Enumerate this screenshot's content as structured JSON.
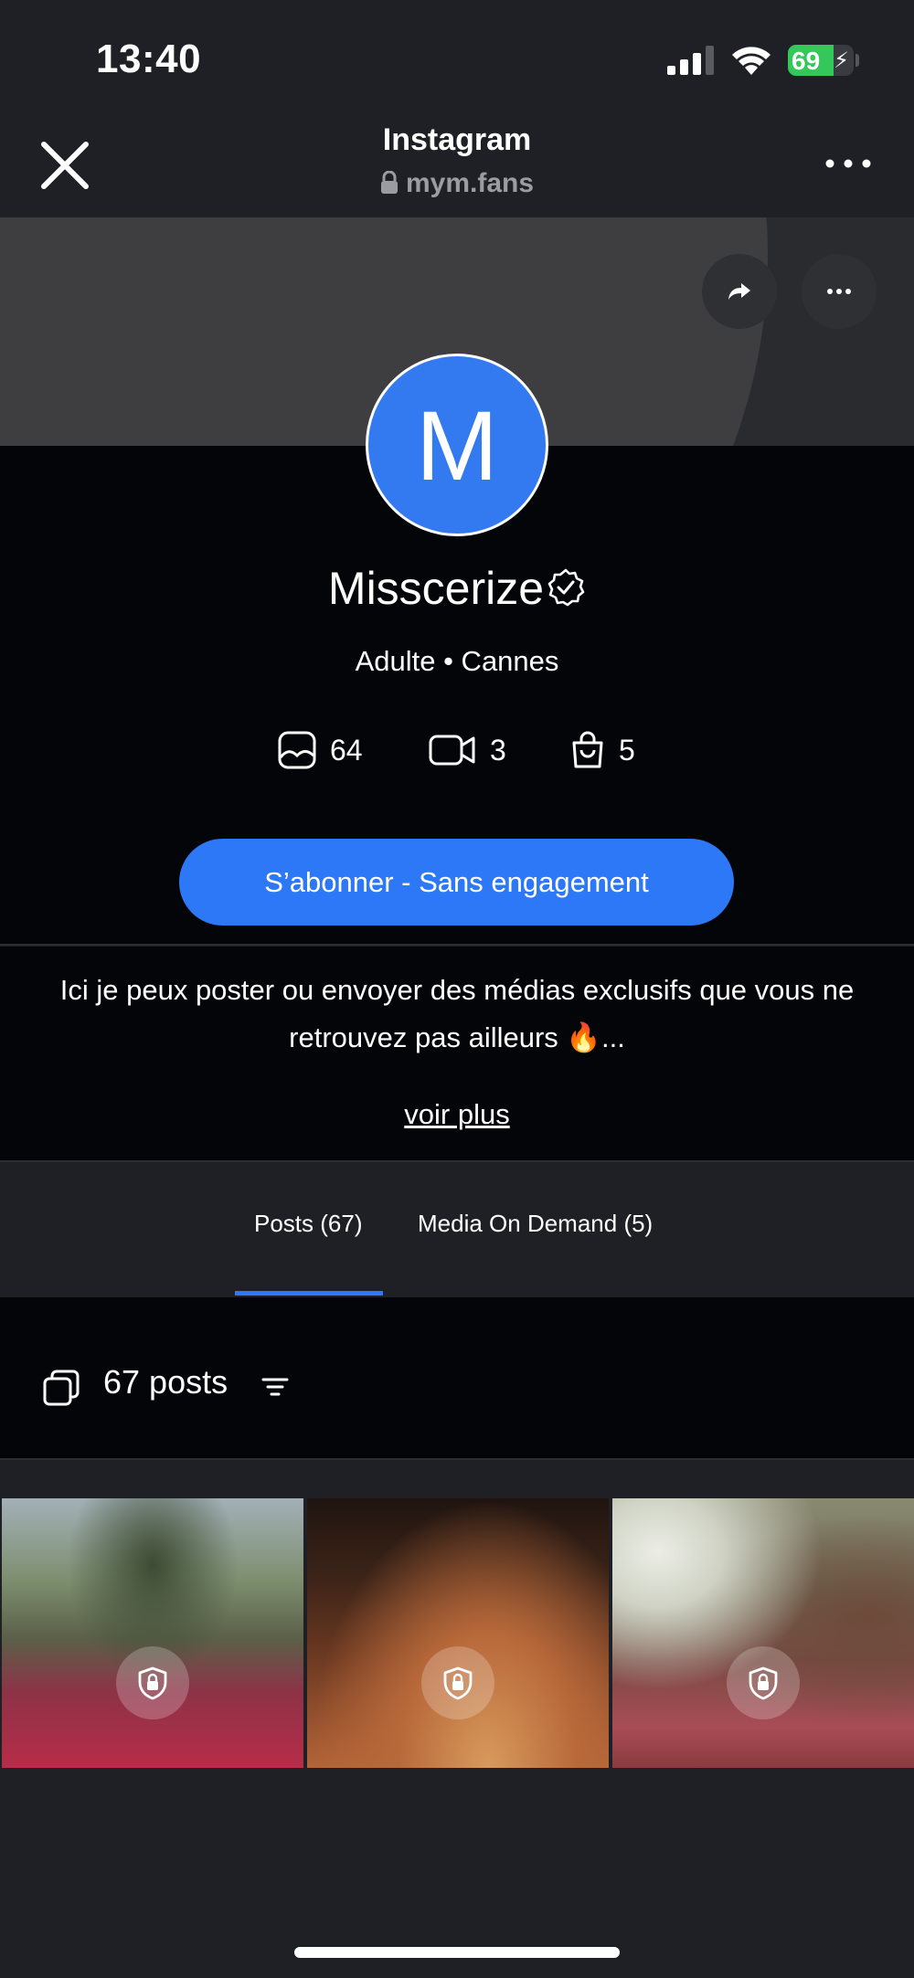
{
  "status_bar": {
    "time": "13:40",
    "battery_level": "69",
    "battery_fraction": 0.69,
    "icons": [
      "signal-icon",
      "wifi-icon",
      "battery-charging-icon"
    ]
  },
  "browser": {
    "title": "Instagram",
    "url": "mym.fans",
    "close_icon": "close-icon",
    "menu_icon": "more-icon"
  },
  "cover": {
    "actions": [
      "share-icon",
      "more-icon"
    ]
  },
  "profile": {
    "avatar_letter": "M",
    "avatar_color": "#3379f0",
    "name": "Misscerize",
    "verified_icon": "verified-badge-icon",
    "subtitle": "Adulte • Cannes",
    "stats": {
      "photos": "64",
      "videos": "3",
      "products": "5"
    },
    "subscribe_label": "S’abonner - Sans engagement",
    "accent_color": "#2d78f6"
  },
  "bio": {
    "text": "Ici je peux poster ou envoyer des médias exclusifs que vous ne retrouvez pas ailleurs 🔥...",
    "see_more": "voir plus"
  },
  "tabs": [
    {
      "label": "Posts (67)",
      "active": true
    },
    {
      "label": "Media On Demand (5)",
      "active": false
    }
  ],
  "posts": {
    "count_label": "67 posts",
    "tiles": [
      {
        "locked": true
      },
      {
        "locked": true
      },
      {
        "locked": true
      }
    ]
  }
}
